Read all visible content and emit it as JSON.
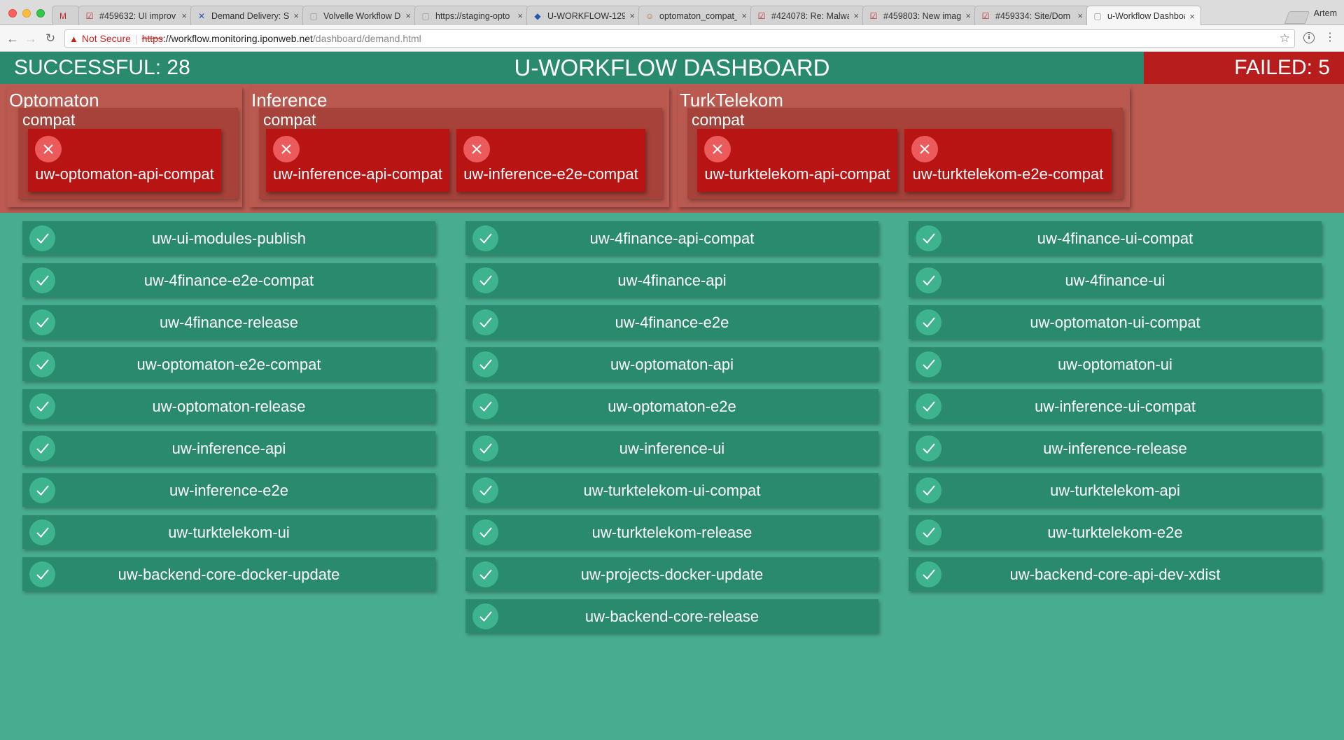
{
  "browser": {
    "tabs": [
      {
        "label": "",
        "icon": "gmail-icon",
        "glyph": "M",
        "color": "#c5221f"
      },
      {
        "label": "#459632: UI improv",
        "icon": "redmine-icon",
        "glyph": "☑",
        "color": "#b22"
      },
      {
        "label": "Demand Delivery: Se",
        "icon": "jira-icon",
        "glyph": "✕",
        "color": "#2457b0"
      },
      {
        "label": "Volvelle Workflow Do",
        "icon": "page-icon",
        "glyph": "▢",
        "color": "#999"
      },
      {
        "label": "https://staging-opto",
        "icon": "page-icon",
        "glyph": "▢",
        "color": "#999"
      },
      {
        "label": "U-WORKFLOW-129",
        "icon": "jira-icon",
        "glyph": "◆",
        "color": "#2457b0"
      },
      {
        "label": "optomaton_compat_",
        "icon": "jenkins-icon",
        "glyph": "☺",
        "color": "#a0764c"
      },
      {
        "label": "#424078: Re: Malwa",
        "icon": "redmine-icon",
        "glyph": "☑",
        "color": "#b22"
      },
      {
        "label": "#459803: New imag",
        "icon": "redmine-icon",
        "glyph": "☑",
        "color": "#b22"
      },
      {
        "label": "#459334: Site/Dom",
        "icon": "redmine-icon",
        "glyph": "☑",
        "color": "#b22"
      },
      {
        "label": "u-Workflow Dashboa",
        "icon": "page-icon",
        "glyph": "▢",
        "color": "#999"
      }
    ],
    "profile_name": "Artem",
    "not_secure": "Not Secure",
    "url_scheme": "https",
    "url_host": "://workflow.monitoring.iponweb.net",
    "url_path": "/dashboard/demand.html"
  },
  "header": {
    "successful": "SUCCESSFUL: 28",
    "title": "U-WORKFLOW DASHBOARD",
    "failed": "FAILED: 5"
  },
  "failed_groups": [
    {
      "name": "Optomaton",
      "subgroups": [
        {
          "name": "compat",
          "jobs": [
            "uw-optomaton-api-compat"
          ]
        }
      ]
    },
    {
      "name": "Inference",
      "subgroups": [
        {
          "name": "compat",
          "jobs": [
            "uw-inference-api-compat",
            "uw-inference-e2e-compat"
          ]
        }
      ]
    },
    {
      "name": "TurkTelekom",
      "subgroups": [
        {
          "name": "compat",
          "jobs": [
            "uw-turktelekom-api-compat",
            "uw-turktelekom-e2e-compat"
          ]
        }
      ]
    }
  ],
  "successful_jobs": {
    "col1": [
      "uw-ui-modules-publish",
      "uw-4finance-e2e-compat",
      "uw-4finance-release",
      "uw-optomaton-e2e-compat",
      "uw-optomaton-release",
      "uw-inference-api",
      "uw-inference-e2e",
      "uw-turktelekom-ui",
      "uw-backend-core-docker-update"
    ],
    "col2": [
      "uw-4finance-api-compat",
      "uw-4finance-api",
      "uw-4finance-e2e",
      "uw-optomaton-api",
      "uw-optomaton-e2e",
      "uw-inference-ui",
      "uw-turktelekom-ui-compat",
      "uw-turktelekom-release",
      "uw-projects-docker-update",
      "uw-backend-core-release"
    ],
    "col3": [
      "uw-4finance-ui-compat",
      "uw-4finance-ui",
      "uw-optomaton-ui-compat",
      "uw-optomaton-ui",
      "uw-inference-ui-compat",
      "uw-inference-release",
      "uw-turktelekom-api",
      "uw-turktelekom-e2e",
      "uw-backend-core-api-dev-xdist"
    ]
  }
}
